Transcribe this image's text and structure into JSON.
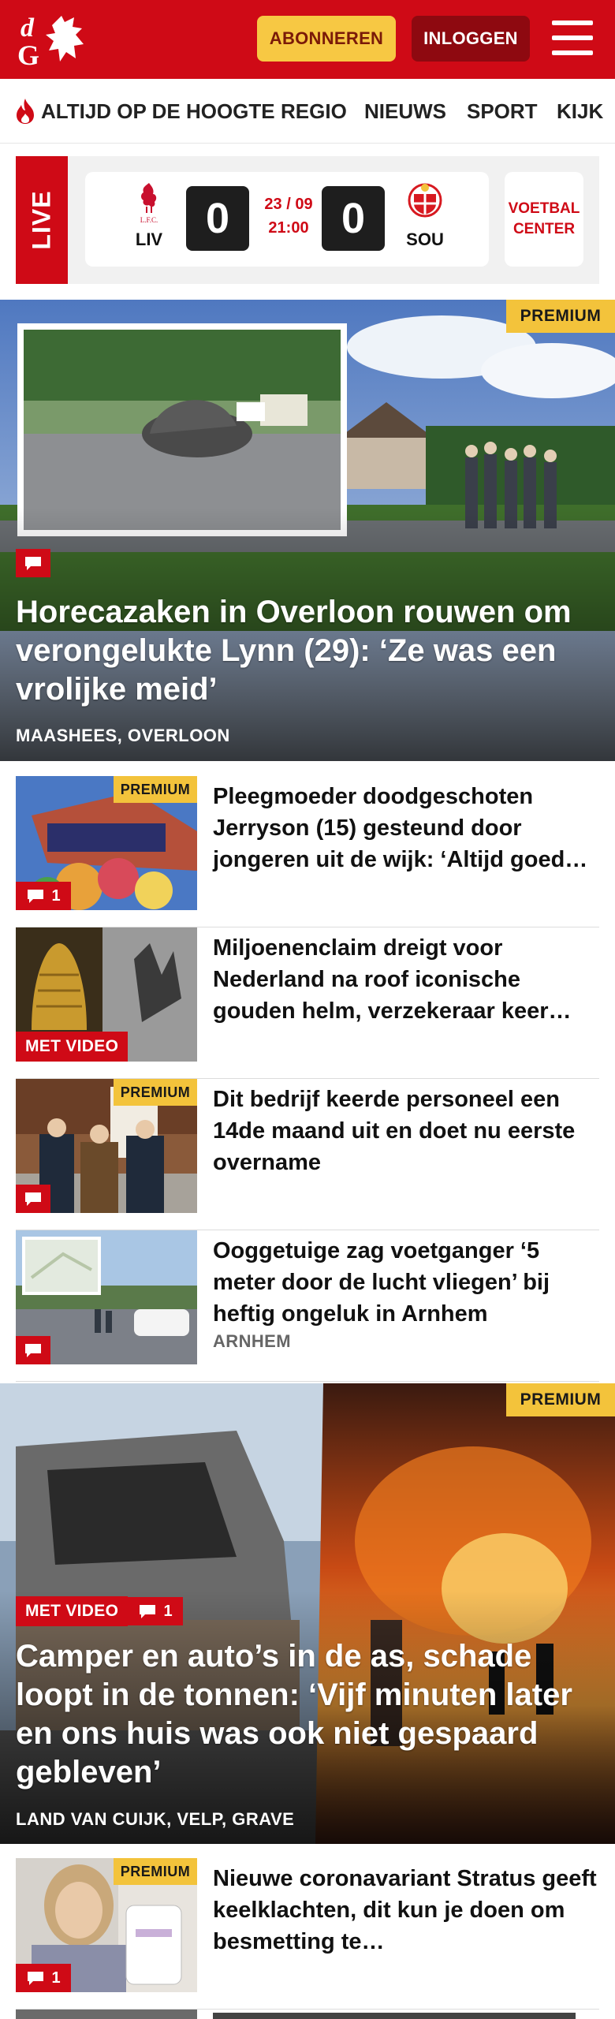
{
  "header": {
    "logo_text": "dG",
    "subscribe_label": "ABONNEREN",
    "login_label": "INLOGGEN",
    "menu_icon": "hamburger-icon",
    "brand_color": "#cf0a16"
  },
  "nav": {
    "items": [
      {
        "label": "ALTIJD OP DE HOOGTE",
        "icon": "flame-icon"
      },
      {
        "label": "REGIO"
      },
      {
        "label": "NIEUWS"
      },
      {
        "label": "SPORT"
      },
      {
        "label": "KIJK"
      }
    ]
  },
  "live": {
    "tag": "LIVE",
    "home": {
      "abbr": "LIV",
      "score": "0",
      "crest_text": "L.F.C."
    },
    "away": {
      "abbr": "SOU",
      "score": "0"
    },
    "date": "23 / 09",
    "time": "21:00",
    "center_label": "VOETBAL CENTER"
  },
  "articles": [
    {
      "type": "hero",
      "premium": "PREMIUM",
      "title": "Horecazaken in Overloon rouwen om verongelukte Lynn (29): ‘Ze was een vrolijke meid’",
      "location": "MAASHEES, OVERLOON",
      "comment_icon": "comment-icon"
    },
    {
      "type": "list",
      "premium": "PREMIUM",
      "title": "Pleegmoeder doodgeschoten Jerryson (15) gesteund door jongeren uit de wijk: ‘Altijd goed…",
      "comments": "1"
    },
    {
      "type": "list",
      "video": "MET VIDEO",
      "title": "Miljoenenclaim dreigt voor Nederland na roof iconische gouden helm, verzekeraar keer…"
    },
    {
      "type": "list",
      "premium": "PREMIUM",
      "title": "Dit bedrijf keerde personeel een 14de maand uit en doet nu eerste overname"
    },
    {
      "type": "list",
      "title": "Ooggetuige zag voetganger ‘5 meter door de lucht vliegen’ bij heftig ongeluk in Arnhem",
      "location": "ARNHEM"
    },
    {
      "type": "hero",
      "premium": "PREMIUM",
      "video": "MET VIDEO",
      "comments": "1",
      "title": "Camper en auto’s in de as, schade loopt in de tonnen: ‘Vijf minuten later en ons huis was ook niet gespaard gebleven’",
      "location": "LAND VAN CUIJK, VELP, GRAVE"
    },
    {
      "type": "list",
      "premium": "PREMIUM",
      "title": "Nieuwe coronavariant Stratus geeft keelklachten, dit kun je doen om besmetting te…",
      "comments": "1"
    }
  ]
}
